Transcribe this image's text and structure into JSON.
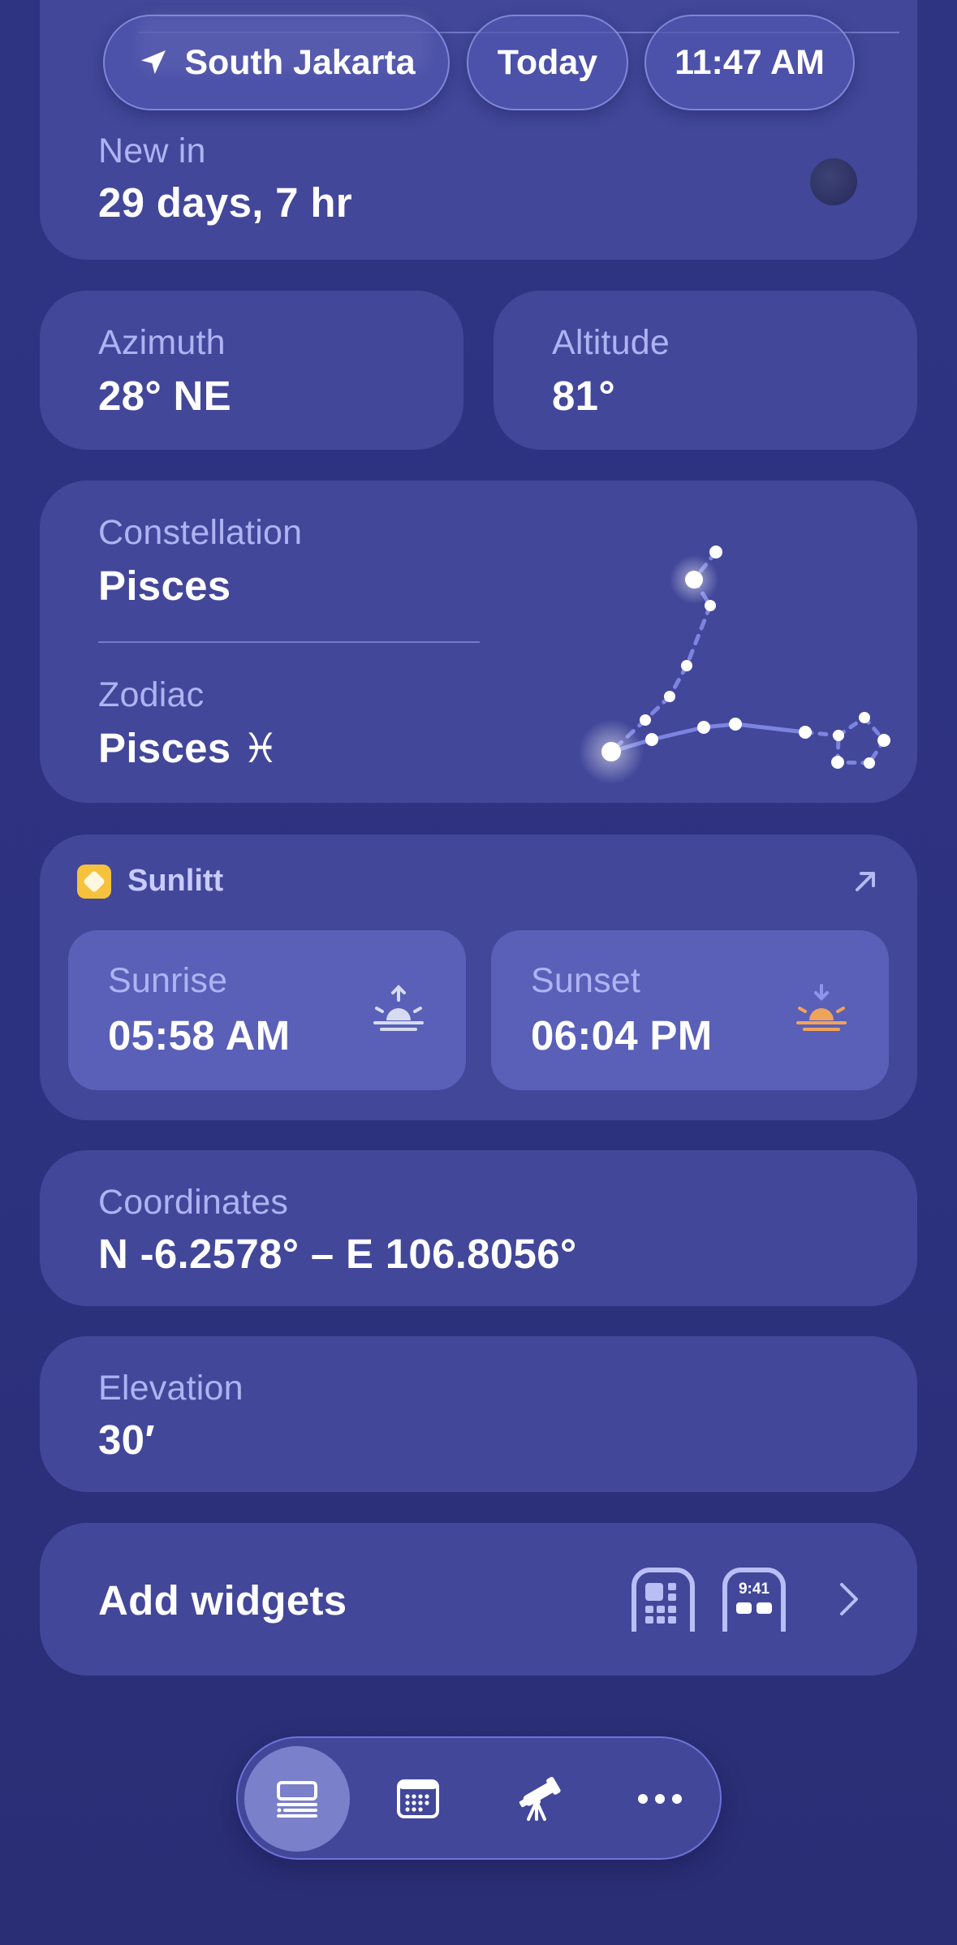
{
  "header": {
    "location": "South Jakarta",
    "date": "Today",
    "time": "11:47 AM"
  },
  "moon": {
    "new_in_label": "New in",
    "new_in_value": "29 days, 7 hr"
  },
  "position": {
    "azimuth_label": "Azimuth",
    "azimuth_value": "28° NE",
    "altitude_label": "Altitude",
    "altitude_value": "81°"
  },
  "constellation": {
    "label": "Constellation",
    "value": "Pisces",
    "zodiac_label": "Zodiac",
    "zodiac_value": "Pisces",
    "zodiac_symbol": "♓︎"
  },
  "sun": {
    "app_name": "Sunlitt",
    "sunrise_label": "Sunrise",
    "sunrise_value": "05:58 AM",
    "sunset_label": "Sunset",
    "sunset_value": "06:04 PM"
  },
  "coordinates": {
    "label": "Coordinates",
    "value": "N -6.2578° – E 106.8056°"
  },
  "elevation": {
    "label": "Elevation",
    "value": "30′"
  },
  "widgets": {
    "label": "Add widgets",
    "widget_time": "9:41"
  },
  "tabbar": {
    "icons": [
      "list-icon",
      "calendar-icon",
      "telescope-icon",
      "more-icon"
    ],
    "selected": "list-icon"
  },
  "colors": {
    "background": "#2d3280",
    "card": "#42479a",
    "subcard": "#5a60b8",
    "label": "#aeb3f2",
    "sunset_accent": "#f0a35a",
    "sunrise_accent": "#d6dcef",
    "app_icon": "#f6c13c"
  }
}
